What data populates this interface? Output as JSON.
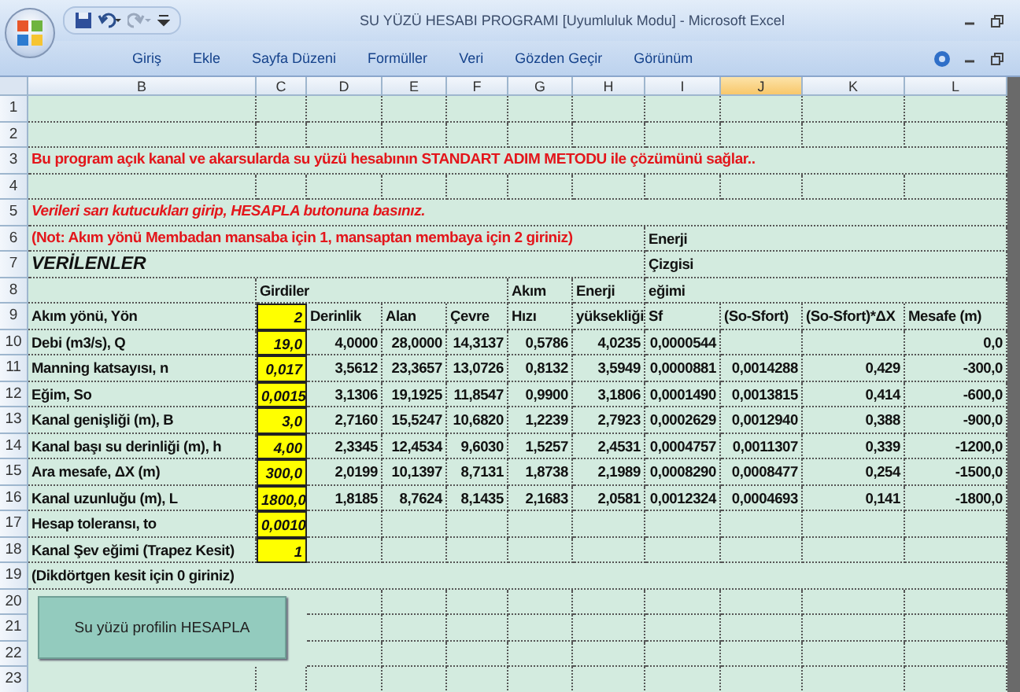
{
  "window": {
    "title": "SU YÜZÜ HESABI PROGRAMI  [Uyumluluk Modu] - Microsoft Excel"
  },
  "ribbon_tabs": [
    {
      "label": "Giriş",
      "selected": false
    },
    {
      "label": "Ekle",
      "selected": false
    },
    {
      "label": "Sayfa Düzeni",
      "selected": false
    },
    {
      "label": "Formüller",
      "selected": false
    },
    {
      "label": "Veri",
      "selected": false
    },
    {
      "label": "Gözden Geçir",
      "selected": false
    },
    {
      "label": "Görünüm",
      "selected": false
    }
  ],
  "columns": [
    {
      "letter": "B",
      "selected": false
    },
    {
      "letter": "C",
      "selected": false
    },
    {
      "letter": "D",
      "selected": false
    },
    {
      "letter": "E",
      "selected": false
    },
    {
      "letter": "F",
      "selected": false
    },
    {
      "letter": "G",
      "selected": false
    },
    {
      "letter": "H",
      "selected": false
    },
    {
      "letter": "I",
      "selected": false
    },
    {
      "letter": "J",
      "selected": true
    },
    {
      "letter": "K",
      "selected": false
    },
    {
      "letter": "L",
      "selected": false
    }
  ],
  "rows": [
    {
      "n": "1",
      "cells": {}
    },
    {
      "n": "2",
      "cells": {}
    },
    {
      "n": "3",
      "cells": {
        "B": {
          "kind": "note",
          "text": "Bu program açık kanal ve akarsularda su yüzü hesabının STANDART ADIM METODU ile çözümünü sağlar.."
        }
      }
    },
    {
      "n": "4",
      "cells": {}
    },
    {
      "n": "5",
      "cells": {
        "B": {
          "kind": "note_italic",
          "text": "Verileri sarı kutucukları girip, HESAPLA butonuna basınız."
        }
      }
    },
    {
      "n": "6",
      "cells": {
        "B": {
          "kind": "note",
          "text": "(Not: Akım yönü Membadan mansaba için 1, mansaptan membaya için 2 giriniz)"
        },
        "I": {
          "kind": "header",
          "text": "Enerji"
        }
      }
    },
    {
      "n": "7",
      "cells": {
        "B": {
          "kind": "heading",
          "text": "VERİLENLER"
        },
        "I": {
          "kind": "header",
          "text": "Çizgisi"
        }
      }
    },
    {
      "n": "8",
      "cells": {
        "C": {
          "kind": "header",
          "text": "Girdiler"
        },
        "G": {
          "kind": "header",
          "text": "Akım"
        },
        "H": {
          "kind": "header",
          "text": "Enerji"
        },
        "I": {
          "kind": "header",
          "text": "eğimi"
        }
      }
    },
    {
      "n": "9",
      "cells": {
        "B": {
          "kind": "label",
          "text": "Akım yönü, Yön"
        },
        "C": {
          "kind": "input",
          "text": "2"
        },
        "D": {
          "kind": "header",
          "text": "Derinlik"
        },
        "E": {
          "kind": "header",
          "text": "Alan"
        },
        "F": {
          "kind": "header",
          "text": "Çevre"
        },
        "G": {
          "kind": "header",
          "text": "Hızı"
        },
        "H": {
          "kind": "header",
          "text": "yüksekliği"
        },
        "I": {
          "kind": "header",
          "text": "Sf"
        },
        "J": {
          "kind": "header",
          "text": "(So-Sfort)"
        },
        "K": {
          "kind": "header",
          "text": "(So-Sfort)*ΔX"
        },
        "L": {
          "kind": "header",
          "text": "Mesafe (m)"
        }
      }
    },
    {
      "n": "10",
      "cells": {
        "B": {
          "kind": "label",
          "text": "Debi (m3/s), Q"
        },
        "C": {
          "kind": "input",
          "text": "19,0"
        },
        "D": {
          "kind": "number",
          "text": "4,0000"
        },
        "E": {
          "kind": "number",
          "text": "28,0000"
        },
        "F": {
          "kind": "number",
          "text": "14,3137"
        },
        "G": {
          "kind": "number",
          "text": "0,5786"
        },
        "H": {
          "kind": "number",
          "text": "4,0235"
        },
        "I": {
          "kind": "number",
          "text": "0,0000544"
        },
        "L": {
          "kind": "number",
          "text": "0,0"
        }
      }
    },
    {
      "n": "11",
      "cells": {
        "B": {
          "kind": "label",
          "text": "Manning katsayısı, n"
        },
        "C": {
          "kind": "input",
          "text": "0,017"
        },
        "D": {
          "kind": "number",
          "text": "3,5612"
        },
        "E": {
          "kind": "number",
          "text": "23,3657"
        },
        "F": {
          "kind": "number",
          "text": "13,0726"
        },
        "G": {
          "kind": "number",
          "text": "0,8132"
        },
        "H": {
          "kind": "number",
          "text": "3,5949"
        },
        "I": {
          "kind": "number",
          "text": "0,0000881"
        },
        "J": {
          "kind": "number",
          "text": "0,0014288"
        },
        "K": {
          "kind": "number",
          "text": "0,429"
        },
        "L": {
          "kind": "number",
          "text": "-300,0"
        }
      }
    },
    {
      "n": "12",
      "cells": {
        "B": {
          "kind": "label",
          "text": "Eğim, So"
        },
        "C": {
          "kind": "input",
          "text": "0,0015"
        },
        "D": {
          "kind": "number",
          "text": "3,1306"
        },
        "E": {
          "kind": "number",
          "text": "19,1925"
        },
        "F": {
          "kind": "number",
          "text": "11,8547"
        },
        "G": {
          "kind": "number",
          "text": "0,9900"
        },
        "H": {
          "kind": "number",
          "text": "3,1806"
        },
        "I": {
          "kind": "number",
          "text": "0,0001490"
        },
        "J": {
          "kind": "number",
          "text": "0,0013815"
        },
        "K": {
          "kind": "number",
          "text": "0,414"
        },
        "L": {
          "kind": "number",
          "text": "-600,0"
        }
      }
    },
    {
      "n": "13",
      "cells": {
        "B": {
          "kind": "label",
          "text": "Kanal genişliği (m), B"
        },
        "C": {
          "kind": "input",
          "text": "3,0"
        },
        "D": {
          "kind": "number",
          "text": "2,7160"
        },
        "E": {
          "kind": "number",
          "text": "15,5247"
        },
        "F": {
          "kind": "number",
          "text": "10,6820"
        },
        "G": {
          "kind": "number",
          "text": "1,2239"
        },
        "H": {
          "kind": "number",
          "text": "2,7923"
        },
        "I": {
          "kind": "number",
          "text": "0,0002629"
        },
        "J": {
          "kind": "number",
          "text": "0,0012940"
        },
        "K": {
          "kind": "number",
          "text": "0,388"
        },
        "L": {
          "kind": "number",
          "text": "-900,0"
        }
      }
    },
    {
      "n": "14",
      "cells": {
        "B": {
          "kind": "label",
          "text": "Kanal başı su derinliği (m), h"
        },
        "C": {
          "kind": "input",
          "text": "4,00"
        },
        "D": {
          "kind": "number",
          "text": "2,3345"
        },
        "E": {
          "kind": "number",
          "text": "12,4534"
        },
        "F": {
          "kind": "number",
          "text": "9,6030"
        },
        "G": {
          "kind": "number",
          "text": "1,5257"
        },
        "H": {
          "kind": "number",
          "text": "2,4531"
        },
        "I": {
          "kind": "number",
          "text": "0,0004757"
        },
        "J": {
          "kind": "number",
          "text": "0,0011307"
        },
        "K": {
          "kind": "number",
          "text": "0,339"
        },
        "L": {
          "kind": "number",
          "text": "-1200,0"
        }
      }
    },
    {
      "n": "15",
      "cells": {
        "B": {
          "kind": "label",
          "text": "Ara mesafe, ΔX (m)"
        },
        "C": {
          "kind": "input",
          "text": "300,0"
        },
        "D": {
          "kind": "number",
          "text": "2,0199"
        },
        "E": {
          "kind": "number",
          "text": "10,1397"
        },
        "F": {
          "kind": "number",
          "text": "8,7131"
        },
        "G": {
          "kind": "number",
          "text": "1,8738"
        },
        "H": {
          "kind": "number",
          "text": "2,1989"
        },
        "I": {
          "kind": "number",
          "text": "0,0008290"
        },
        "J": {
          "kind": "number",
          "text": "0,0008477"
        },
        "K": {
          "kind": "number",
          "text": "0,254"
        },
        "L": {
          "kind": "number",
          "text": "-1500,0"
        }
      }
    },
    {
      "n": "16",
      "cells": {
        "B": {
          "kind": "label",
          "text": "Kanal uzunluğu (m), L"
        },
        "C": {
          "kind": "input",
          "text": "1800,0"
        },
        "D": {
          "kind": "number",
          "text": "1,8185"
        },
        "E": {
          "kind": "number",
          "text": "8,7624"
        },
        "F": {
          "kind": "number",
          "text": "8,1435"
        },
        "G": {
          "kind": "number",
          "text": "2,1683"
        },
        "H": {
          "kind": "number",
          "text": "2,0581"
        },
        "I": {
          "kind": "number",
          "text": "0,0012324"
        },
        "J": {
          "kind": "number",
          "text": "0,0004693"
        },
        "K": {
          "kind": "number",
          "text": "0,141"
        },
        "L": {
          "kind": "number",
          "text": "-1800,0"
        }
      }
    },
    {
      "n": "17",
      "cells": {
        "B": {
          "kind": "label",
          "text": "Hesap toleransı, to"
        },
        "C": {
          "kind": "input",
          "text": "0,0010"
        }
      }
    },
    {
      "n": "18",
      "cells": {
        "B": {
          "kind": "label",
          "text": "Kanal  Şev eğimi (Trapez Kesit)"
        },
        "C": {
          "kind": "input",
          "text": "1"
        }
      }
    },
    {
      "n": "19",
      "cells": {
        "B": {
          "kind": "label",
          "text": "(Dikdörtgen kesit için 0 giriniz)"
        }
      }
    },
    {
      "n": "20",
      "cells": {}
    },
    {
      "n": "21",
      "cells": {}
    },
    {
      "n": "22",
      "cells": {}
    },
    {
      "n": "23",
      "cells": {}
    }
  ],
  "button": {
    "label": "Su yüzü profilin HESAPLA"
  }
}
